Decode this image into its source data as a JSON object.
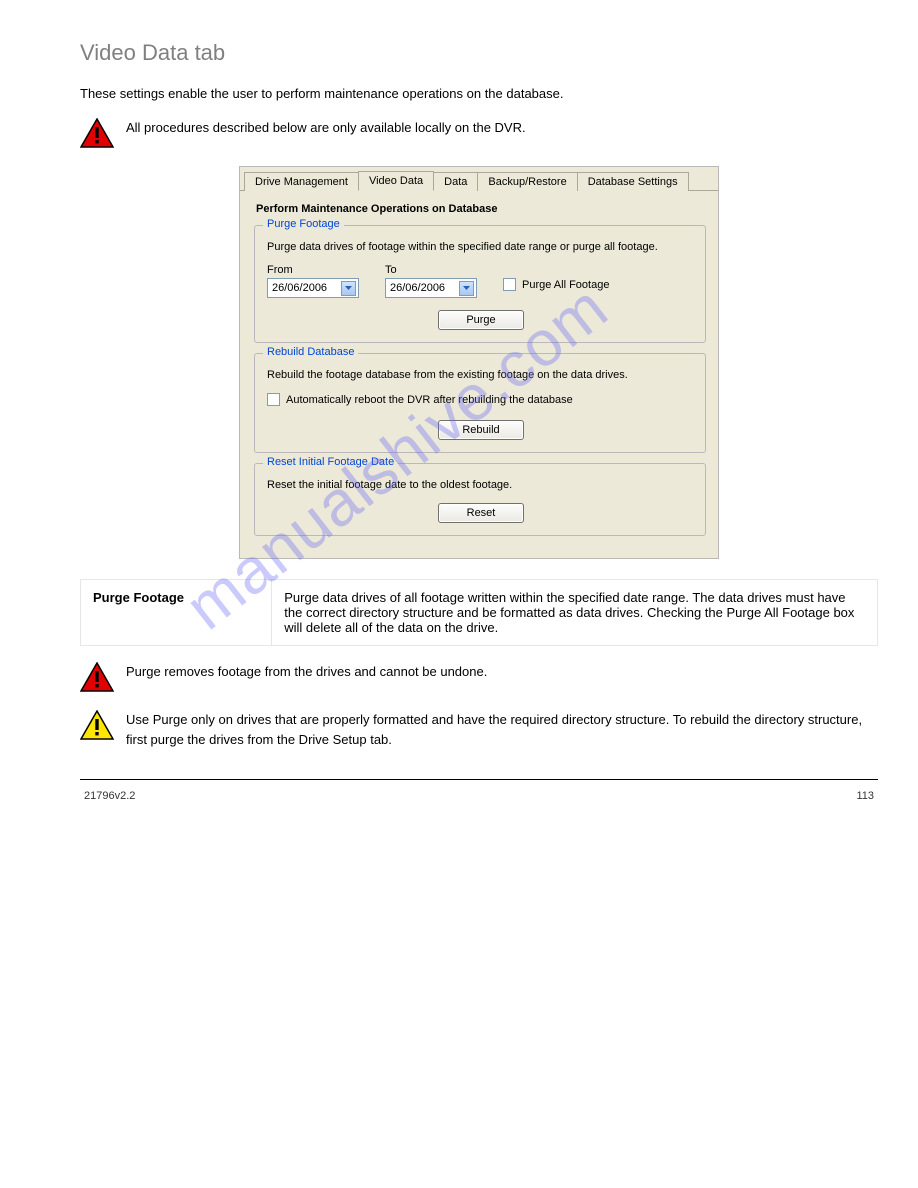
{
  "section_title": "Video Data tab",
  "intro_text": "These settings enable the user to perform maintenance operations on the database.",
  "warning1": "All procedures described below are only available locally on the DVR.",
  "shot": {
    "tabs": [
      "Drive Management",
      "Video Data",
      "Data",
      "Backup/Restore",
      "Database Settings"
    ],
    "active_tab_index": 1,
    "heading": "Perform Maintenance Operations on Database",
    "purge": {
      "legend": "Purge Footage",
      "desc": "Purge data drives of footage within the specified date range or purge all footage.",
      "from_label": "From",
      "to_label": "To",
      "from_value": "26/06/2006",
      "to_value": "26/06/2006",
      "checkbox_label": "Purge All Footage",
      "button": "Purge"
    },
    "rebuild": {
      "legend": "Rebuild Database",
      "desc": "Rebuild the footage database from the existing footage on the data drives.",
      "checkbox_label": "Automatically reboot the DVR after rebuilding the database",
      "button": "Rebuild"
    },
    "reset": {
      "legend": "Reset Initial Footage Date",
      "desc": "Reset the initial footage date to the oldest footage.",
      "button": "Reset"
    }
  },
  "defs": {
    "term": "Purge Footage",
    "body": "Purge data drives of all footage written within the specified date range. The data drives must have the correct directory structure and be formatted as data drives. Checking the Purge All Footage box will delete all of the data on the drive."
  },
  "warning2": "Purge removes footage from the drives and cannot be undone.",
  "caution1": "Use Purge only on drives that are properly formatted and have the required directory structure. To rebuild the directory structure, first purge the drives from the Drive Setup tab.",
  "watermark": "manualshive.com",
  "footer_left": "21796v2.2",
  "footer_right": "113"
}
